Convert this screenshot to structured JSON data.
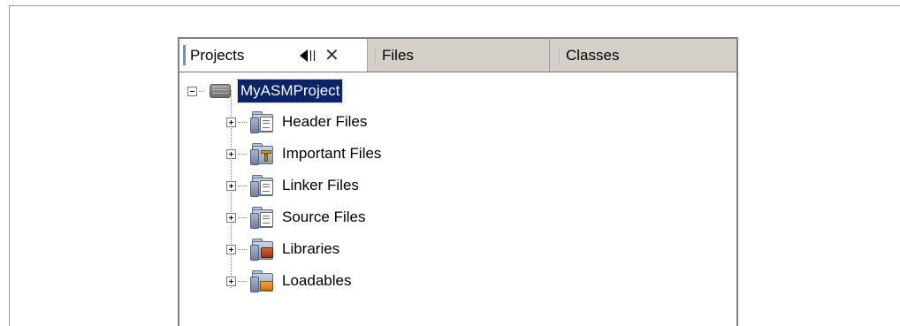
{
  "tabs": [
    {
      "label": "Projects",
      "active": true
    },
    {
      "label": "Files",
      "active": false
    },
    {
      "label": "Classes",
      "active": false
    }
  ],
  "project": {
    "name": "MyASMProject",
    "selected": true,
    "icon": "chip-icon"
  },
  "tree_items": [
    {
      "label": "Header Files",
      "icon": "folder-document-icon",
      "expanded": false
    },
    {
      "label": "Important Files",
      "icon": "folder-important-icon",
      "expanded": false
    },
    {
      "label": "Linker Files",
      "icon": "folder-document-icon",
      "expanded": false
    },
    {
      "label": "Source Files",
      "icon": "folder-document-icon",
      "expanded": false
    },
    {
      "label": "Libraries",
      "icon": "folder-library-icon",
      "expanded": false
    },
    {
      "label": "Loadables",
      "icon": "folder-loadable-icon",
      "expanded": false
    }
  ],
  "colors": {
    "selection_bg": "#0a246a",
    "selection_fg": "#ffffff",
    "tabbar_bg": "#d4d0c8",
    "active_tab_marker": "#6b8fd6"
  }
}
